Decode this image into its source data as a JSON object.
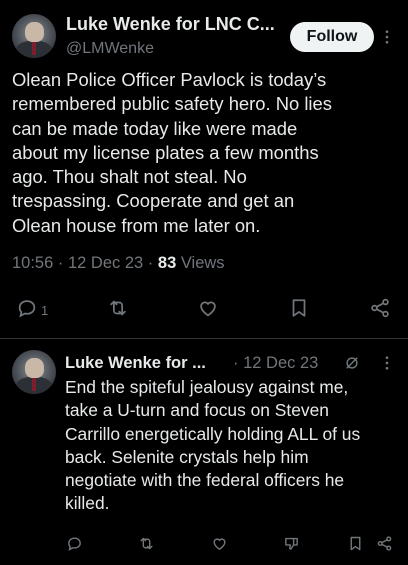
{
  "main_tweet": {
    "author_name": "Luke Wenke for LNC C...",
    "handle": "@LMWenke",
    "follow_label": "Follow",
    "text": "Olean Police Officer Pavlock is today’s\nremembered public safety hero.  No lies\ncan be made today like were made\nabout my license plates a few months\nago.  Thou shalt not steal.  No\ntrespassing.  Cooperate and get an\nOlean house from me later on.",
    "time": "10:56",
    "date": "12 Dec 23",
    "views_count": "83",
    "views_label": "Views",
    "reply_count": "1"
  },
  "reply_tweet": {
    "author_name": "Luke Wenke for ...",
    "date": "12 Dec 23",
    "text": "End the spiteful jealousy against me,\ntake a U-turn and focus on Steven\nCarrillo energetically holding ALL of us\nback.  Selenite crystals help him\nnegotiate with the federal officers he\nkilled."
  },
  "icons": [
    "avatar",
    "more-icon",
    "reply-icon",
    "retweet-icon",
    "like-icon",
    "bookmark-icon",
    "share-icon",
    "grok-icon",
    "downvote-icon"
  ],
  "colors": {
    "background": "#000000",
    "text_primary": "#e7e9ea",
    "text_secondary": "#71767b",
    "follow_bg": "#eff3f4",
    "divider": "#2f3336"
  }
}
